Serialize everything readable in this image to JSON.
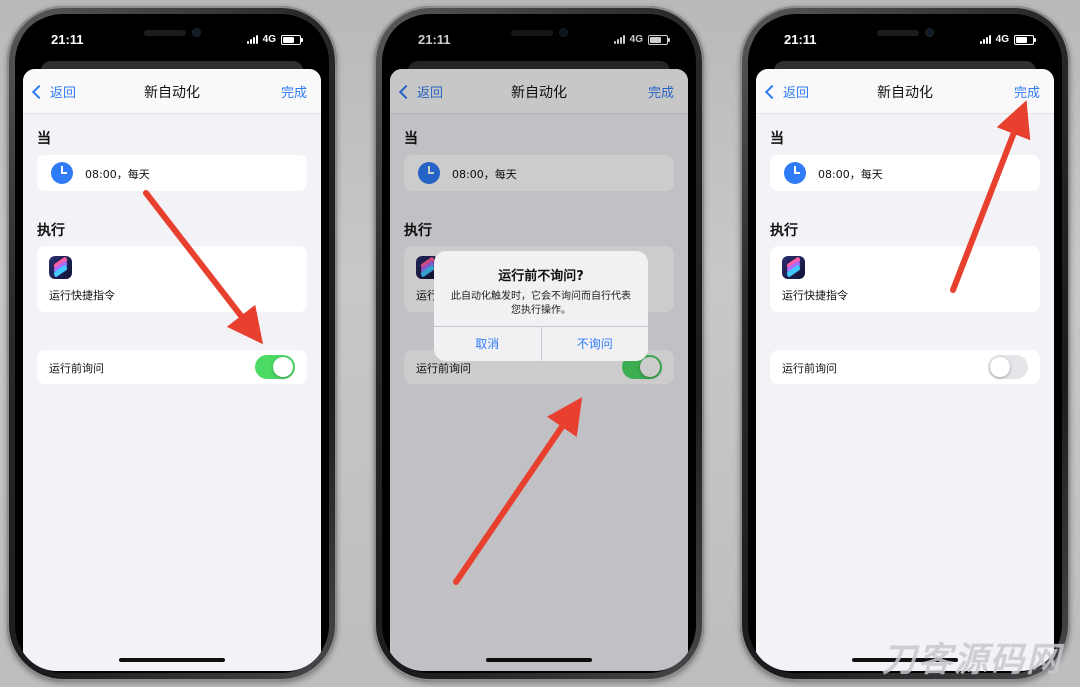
{
  "status": {
    "time": "21:11",
    "network": "4G"
  },
  "nav": {
    "back": "返回",
    "title": "新自动化",
    "done": "完成"
  },
  "sections": {
    "when": "当",
    "do": "执行"
  },
  "trigger": {
    "text": "08:00，每天"
  },
  "action": {
    "label": "运行快捷指令"
  },
  "ask": {
    "label": "运行前询问"
  },
  "phones": [
    {
      "ask_toggle": "on"
    },
    {
      "ask_toggle": "on",
      "alert": true
    },
    {
      "ask_toggle": "off"
    }
  ],
  "alert": {
    "title": "运行前不询问?",
    "message": "此自动化触发时，它会不询问而自行代表您执行操作。",
    "cancel": "取消",
    "confirm": "不询问"
  },
  "colors": {
    "accent": "#2f7cf6",
    "toggle_on": "#4cd964",
    "arrow": "#e8402e"
  },
  "watermark": "刀客源码网"
}
